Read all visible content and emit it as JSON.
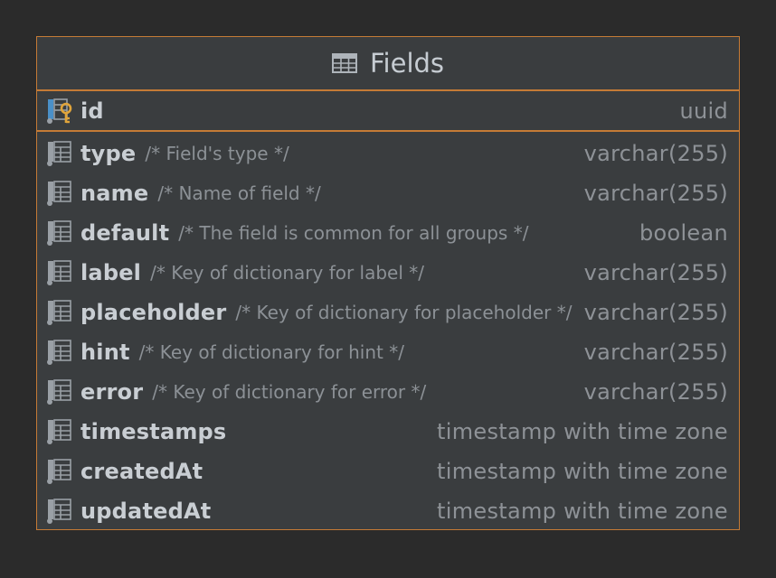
{
  "table": {
    "title": "Fields",
    "primary_key": {
      "name": "id",
      "type": "uuid",
      "icon": "primary-key-column-icon"
    },
    "columns": [
      {
        "name": "type",
        "comment": "/* Field's type */",
        "type": "varchar(255)",
        "icon": "column-icon"
      },
      {
        "name": "name",
        "comment": "/* Name of field */",
        "type": "varchar(255)",
        "icon": "column-icon"
      },
      {
        "name": "default",
        "comment": "/* The field is common for all groups */",
        "type": "boolean",
        "icon": "column-icon"
      },
      {
        "name": "label",
        "comment": "/* Key of dictionary for label */",
        "type": "varchar(255)",
        "icon": "column-icon"
      },
      {
        "name": "placeholder",
        "comment": "/* Key of dictionary for placeholder */",
        "type": "varchar(255)",
        "icon": "column-icon"
      },
      {
        "name": "hint",
        "comment": "/* Key of dictionary for hint */",
        "type": "varchar(255)",
        "icon": "column-icon"
      },
      {
        "name": "error",
        "comment": "/* Key of dictionary for error */",
        "type": "varchar(255)",
        "icon": "column-icon"
      },
      {
        "name": "timestamps",
        "comment": "",
        "type": "timestamp with time zone",
        "icon": "column-icon"
      },
      {
        "name": "createdAt",
        "comment": "",
        "type": "timestamp with time zone",
        "icon": "column-icon"
      },
      {
        "name": "updatedAt",
        "comment": "",
        "type": "timestamp with time zone",
        "icon": "column-icon"
      }
    ]
  },
  "colors": {
    "background": "#2b2b2b",
    "panel": "#3a3d3f",
    "border_accent": "#c57b36",
    "key_gold": "#e0a43a",
    "primary_key_blue": "#4a90c8"
  }
}
